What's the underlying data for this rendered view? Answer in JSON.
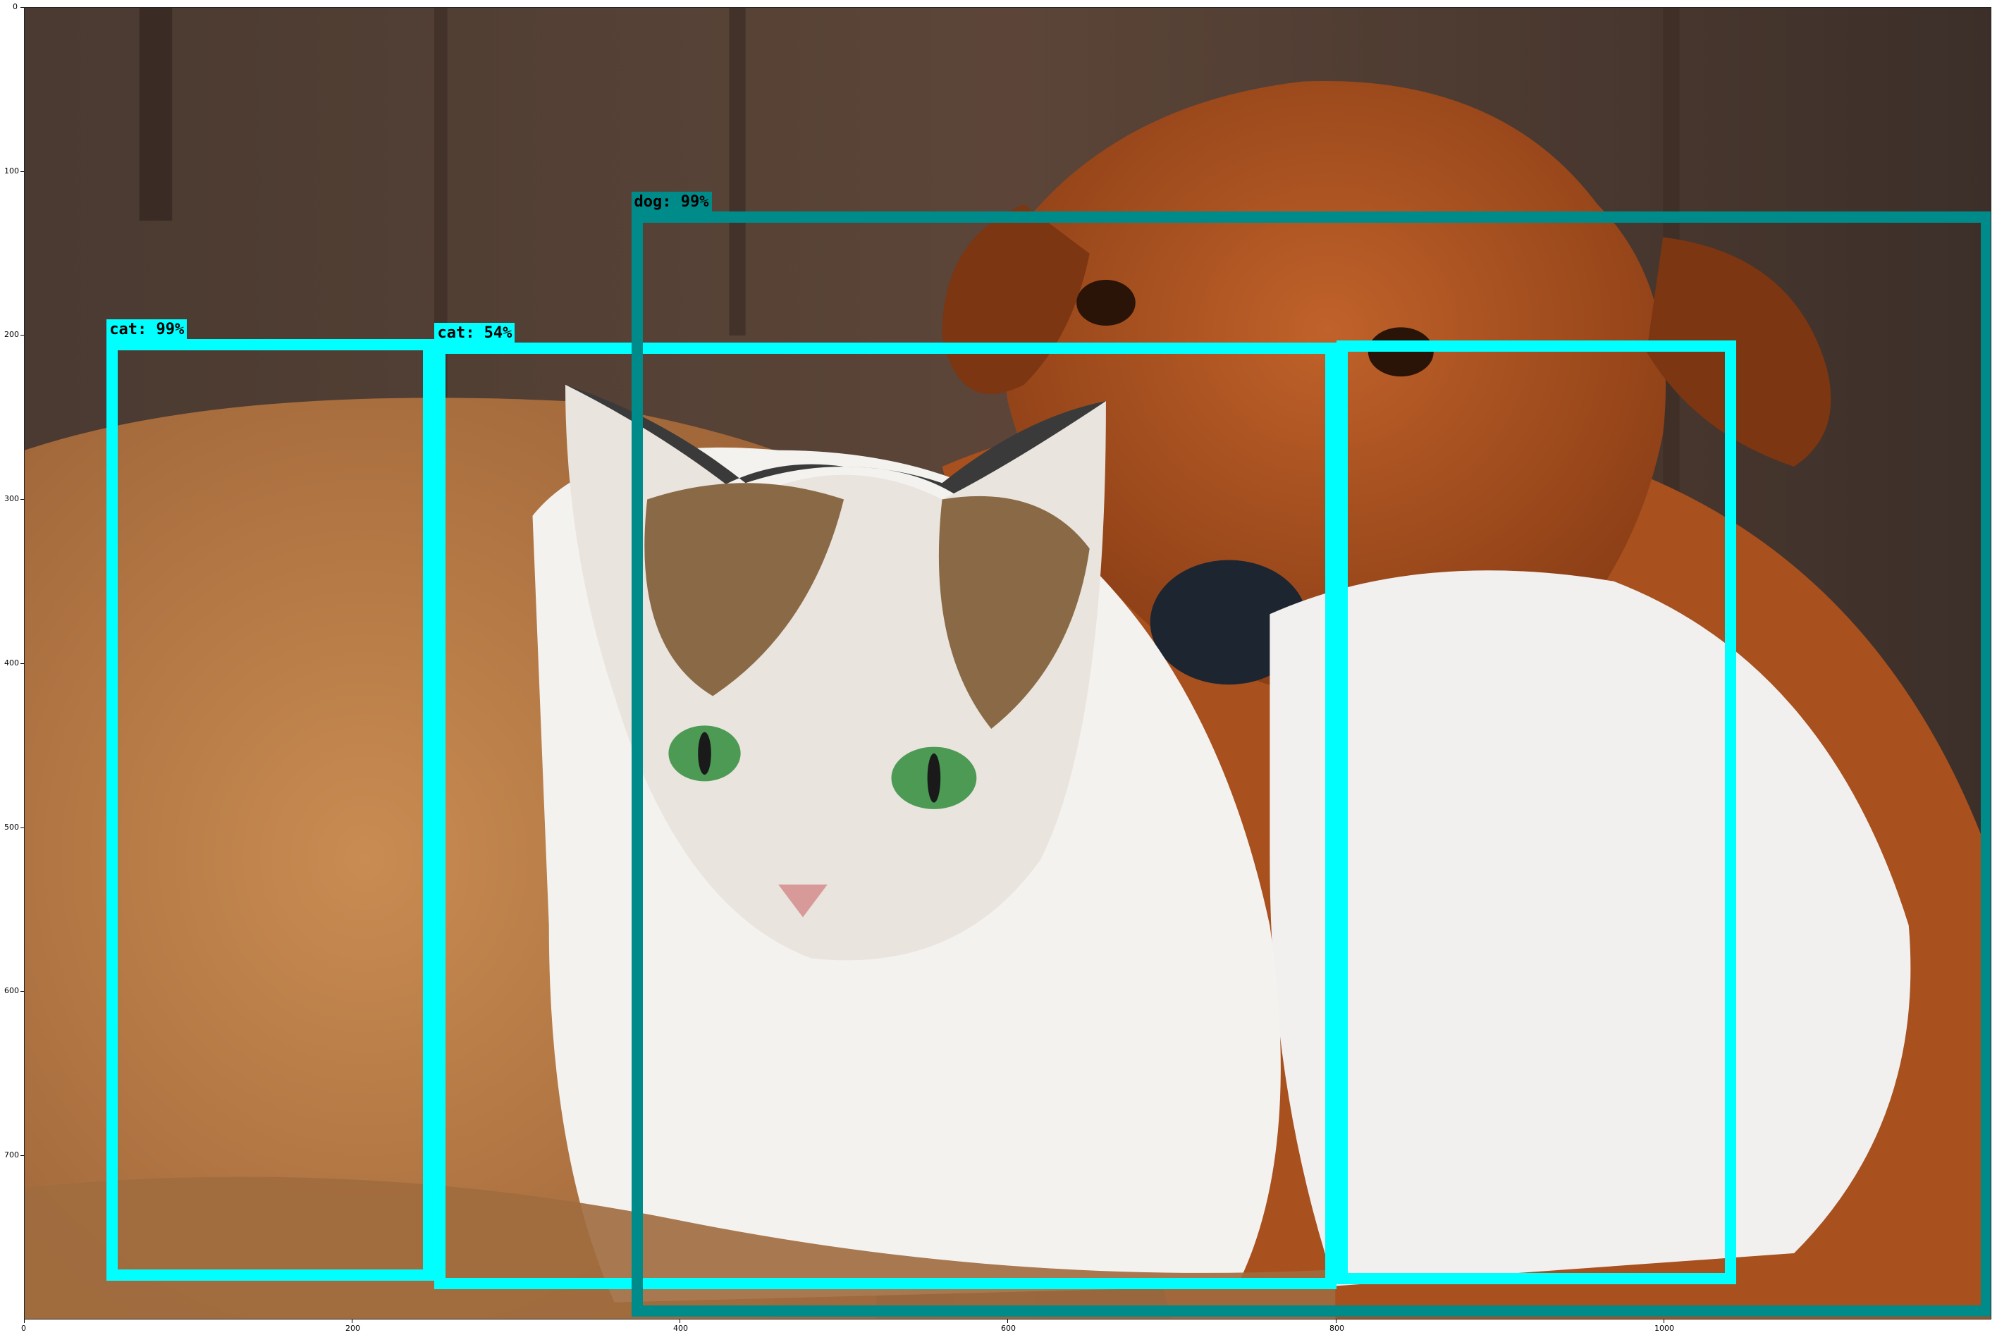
{
  "image": {
    "description_subject": "photo",
    "x_ticks": [
      "0",
      "200",
      "400",
      "600",
      "800",
      "1000"
    ],
    "y_ticks": [
      "0",
      "100",
      "200",
      "300",
      "400",
      "500",
      "600",
      "700"
    ]
  },
  "detections": [
    {
      "label": "cat: 99%",
      "class": "cat",
      "score": 0.99,
      "color": "#00FFFF",
      "xmin": 50,
      "ymin": 202,
      "xmax": 250,
      "ymax": 776
    },
    {
      "label": "cat: 54%",
      "class": "cat",
      "score": 0.54,
      "color": "#00FFFF",
      "xmin": 250,
      "ymin": 204,
      "xmax": 800,
      "ymax": 781
    },
    {
      "label": "",
      "class": "cat",
      "score": null,
      "color": "#00FFFF",
      "xmin": 800,
      "ymin": 203,
      "xmax": 1044,
      "ymax": 778
    },
    {
      "label": "dog: 99%",
      "class": "dog",
      "score": 0.99,
      "color": "#008B8B",
      "xmin": 370,
      "ymin": 124,
      "xmax": 1200,
      "ymax": 798
    }
  ],
  "colors": {
    "cat_box": "#00FFFF",
    "dog_box": "#008B8B"
  }
}
